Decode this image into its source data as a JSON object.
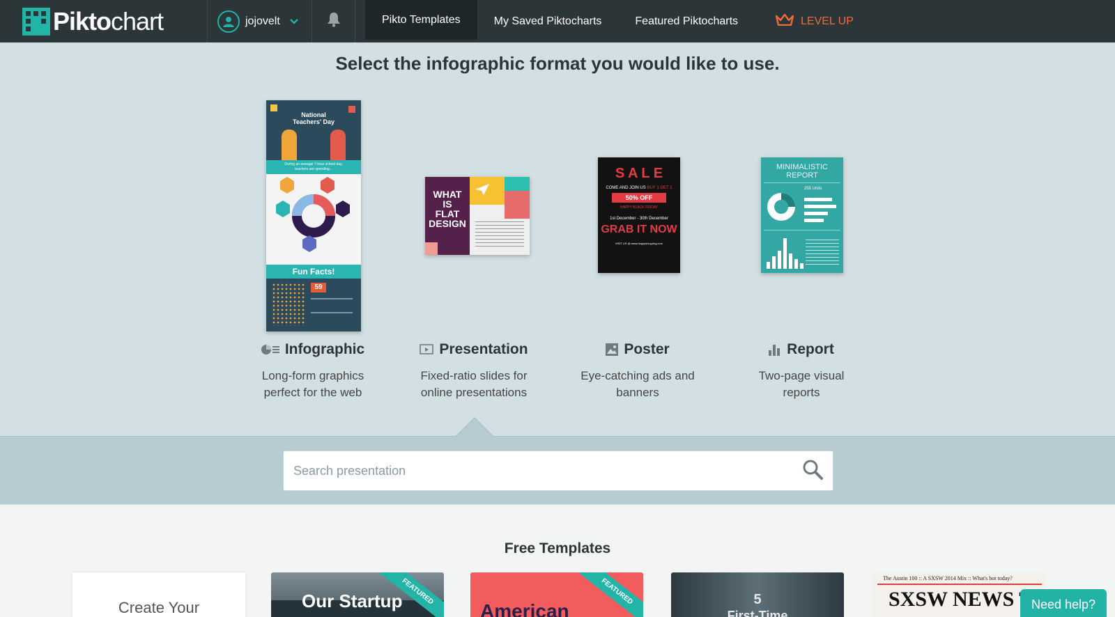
{
  "nav": {
    "logo_bold": "Pikto",
    "logo_thin": "chart",
    "username": "jojovelt",
    "tabs": [
      {
        "label": "Pikto Templates"
      },
      {
        "label": "My Saved Piktocharts"
      },
      {
        "label": "Featured Piktocharts"
      }
    ],
    "level_up": "LEVEL UP"
  },
  "heading": "Select the infographic format you would like to use.",
  "formats": [
    {
      "title": "Infographic",
      "desc1": "Long-form graphics",
      "desc2": "perfect for the web",
      "icon": "pie-list-icon"
    },
    {
      "title": "Presentation",
      "desc1": "Fixed-ratio slides for",
      "desc2": "online presentations",
      "icon": "slides-icon"
    },
    {
      "title": "Poster",
      "desc1": "Eye-catching ads and",
      "desc2": "banners",
      "icon": "image-icon"
    },
    {
      "title": "Report",
      "desc1": "Two-page visual",
      "desc2": "reports",
      "icon": "bar-chart-icon"
    }
  ],
  "thumbs": {
    "infographic": {
      "l1": "National",
      "l2": "Teachers' Day",
      "l3": "During an average 7-hour school day,",
      "l4": "teachers are spending...",
      "fun": "Fun Facts!",
      "num": "59"
    },
    "presentation": {
      "t1": "WHAT",
      "t2": "IS",
      "t3": "FLAT",
      "t4": "DESIGN"
    },
    "poster": {
      "sale": "S A L E",
      "l1": "COME AND JOIN US",
      "l1b": "BUY 1 GET 1",
      "off": "50% OFF",
      "l2": "HAPPY BLACK FRIDAY",
      "date": "1st December - 30th December",
      "grab": "GRAB IT NOW",
      "url": "VISIT US @ www.happyshopping.com"
    },
    "report": {
      "t1": "MINIMALISTIC",
      "t2": "REPORT",
      "units": "255 Units"
    }
  },
  "search": {
    "placeholder": "Search presentation"
  },
  "free_templates": {
    "title": "Free Templates",
    "cards": [
      {
        "label": "Create Your"
      },
      {
        "label": "Our Startup",
        "ribbon": "FEATURED"
      },
      {
        "label": "American",
        "ribbon": "FEATURED"
      },
      {
        "label": "5",
        "sub": "First-Time"
      },
      {
        "label": "SXSW NEWS TODAY",
        "top": "The Austin 100  ::  A SXSW 2014 Mix  ::  What's hot today?"
      }
    ]
  },
  "help": "Need help?",
  "colors": {
    "nav_bg": "#2c3538",
    "accent": "#21b4a7",
    "level_up": "#ef6b3a",
    "page_bg": "#d3e0e3"
  }
}
